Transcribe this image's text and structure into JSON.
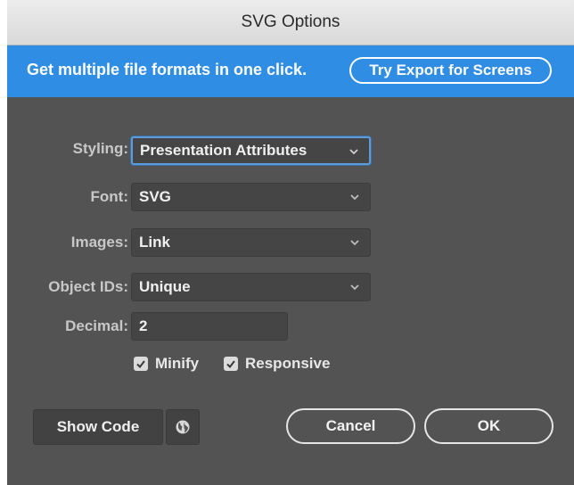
{
  "window": {
    "title": "SVG Options"
  },
  "banner": {
    "message": "Get multiple file formats in one click.",
    "button_label": "Try Export for Screens"
  },
  "form": {
    "styling": {
      "label": "Styling:",
      "value": "Presentation Attributes"
    },
    "font": {
      "label": "Font:",
      "value": "SVG"
    },
    "images": {
      "label": "Images:",
      "value": "Link"
    },
    "object_ids": {
      "label": "Object IDs:",
      "value": "Unique"
    },
    "decimal": {
      "label": "Decimal:",
      "value": "2"
    },
    "minify": {
      "label": "Minify",
      "checked": true
    },
    "responsive": {
      "label": "Responsive",
      "checked": true
    }
  },
  "footer": {
    "show_code_label": "Show Code",
    "globe_icon": "globe-icon",
    "cancel_label": "Cancel",
    "ok_label": "OK"
  },
  "colors": {
    "panel_bg": "#535353",
    "banner_bg": "#2f8de4",
    "focus_ring": "#5e9bd8"
  }
}
